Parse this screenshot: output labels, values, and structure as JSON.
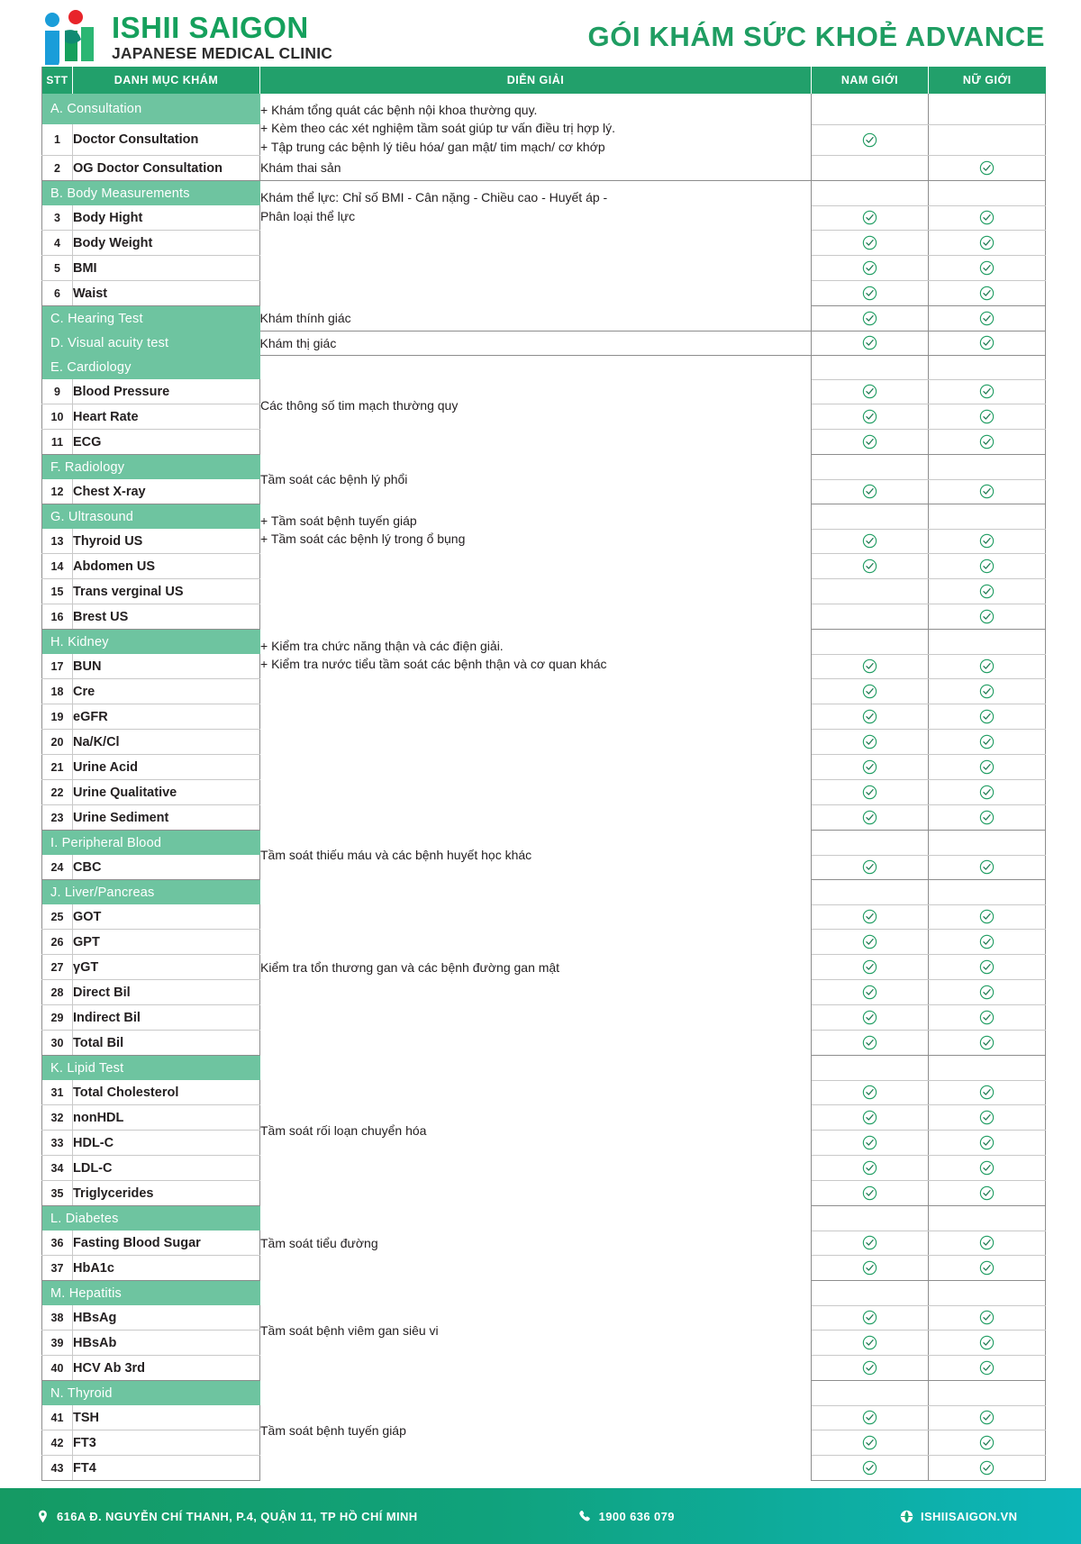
{
  "brand": {
    "name": "ISHII SAIGON",
    "tagline": "JAPANESE MEDICAL CLINIC",
    "logo_icon": "ishii-logo-icon",
    "green": "#15a05c",
    "red": "#e8242a",
    "blue": "#1a9dd9"
  },
  "document": {
    "title": "GÓI KHÁM SỨC KHOẺ ADVANCE",
    "header_green": "#22a06b",
    "section_green": "#6ec4a0",
    "tick_green": "#1f9d62"
  },
  "table": {
    "columns": [
      "STT",
      "DANH MỤC KHÁM",
      "DIỄN GIẢI",
      "NAM GIỚI",
      "NỮ GIỚI"
    ],
    "groups": [
      {
        "section": "A. Consultation",
        "section_has_desc": false,
        "blocks": [
          {
            "desc": "+ Khám tổng quát các bệnh nội khoa thường quy.\n+ Kèm theo các xét nghiệm tầm soát giúp tư vấn điều trị hợp lý.\n+ Tập trung các bệnh lý tiêu hóa/ gan mật/ tim mạch/ cơ khớp",
            "desc_spans_section": true,
            "rows": [
              {
                "stt": "1",
                "name": "Doctor Consultation",
                "male": true,
                "female": false
              }
            ]
          },
          {
            "desc": "Khám thai sản",
            "rows": [
              {
                "stt": "2",
                "name": "OG Doctor Consultation",
                "male": false,
                "female": true
              }
            ]
          }
        ]
      },
      {
        "section": "B. Body Measurements",
        "blocks": [
          {
            "desc": "Khám thể lực: Chỉ số BMI - Cân nặng - Chiều cao - Huyết áp -\nPhân loại thể lực",
            "desc_spans_section": true,
            "rows": [
              {
                "stt": "3",
                "name": "Body Hight",
                "male": true,
                "female": true
              },
              {
                "stt": "4",
                "name": "Body Weight",
                "male": true,
                "female": true
              },
              {
                "stt": "5",
                "name": "BMI",
                "male": true,
                "female": true
              },
              {
                "stt": "6",
                "name": "Waist",
                "male": true,
                "female": true
              }
            ]
          }
        ]
      },
      {
        "section": "C. Hearing Test",
        "section_inline_desc": "Khám thính giác",
        "section_male": true,
        "section_female": true,
        "blocks": []
      },
      {
        "section": "D. Visual acuity test",
        "section_inline_desc": "Khám thị giác",
        "section_male": true,
        "section_female": true,
        "blocks": []
      },
      {
        "section": "E. Cardiology",
        "blocks": [
          {
            "desc": "Các thông số tim mạch thường quy",
            "desc_spans_section": true,
            "rows": [
              {
                "stt": "9",
                "name": "Blood Pressure",
                "male": true,
                "female": true
              },
              {
                "stt": "10",
                "name": "Heart Rate",
                "male": true,
                "female": true
              },
              {
                "stt": "11",
                "name": "ECG",
                "male": true,
                "female": true
              }
            ]
          }
        ]
      },
      {
        "section": "F. Radiology",
        "blocks": [
          {
            "desc": "Tầm soát các bệnh lý phổi",
            "desc_spans_section": true,
            "rows": [
              {
                "stt": "12",
                "name": "Chest X-ray",
                "male": true,
                "female": true
              }
            ]
          }
        ]
      },
      {
        "section": "G. Ultrasound",
        "blocks": [
          {
            "desc": "+ Tầm soát bệnh tuyến giáp\n+ Tầm soát các bệnh lý trong ổ bụng",
            "desc_spans_section": true,
            "rows": [
              {
                "stt": "13",
                "name": "Thyroid US",
                "male": true,
                "female": true
              },
              {
                "stt": "14",
                "name": "Abdomen US",
                "male": true,
                "female": true
              },
              {
                "stt": "15",
                "name": "Trans verginal US",
                "male": false,
                "female": true
              },
              {
                "stt": "16",
                "name": "Brest US",
                "male": false,
                "female": true
              }
            ]
          }
        ]
      },
      {
        "section": "H. Kidney",
        "blocks": [
          {
            "desc": "+ Kiểm tra chức năng thận và các điện giải.\n+ Kiểm tra nước tiểu tầm soát các bệnh thận và cơ quan khác",
            "desc_spans_section": true,
            "rows": [
              {
                "stt": "17",
                "name": "BUN",
                "male": true,
                "female": true
              },
              {
                "stt": "18",
                "name": "Cre",
                "male": true,
                "female": true
              },
              {
                "stt": "19",
                "name": "eGFR",
                "male": true,
                "female": true
              },
              {
                "stt": "20",
                "name": "Na/K/Cl",
                "male": true,
                "female": true
              },
              {
                "stt": "21",
                "name": "Urine Acid",
                "male": true,
                "female": true
              },
              {
                "stt": "22",
                "name": "Urine Qualitative",
                "male": true,
                "female": true
              },
              {
                "stt": "23",
                "name": "Urine Sediment",
                "male": true,
                "female": true
              }
            ]
          }
        ]
      },
      {
        "section": "I. Peripheral Blood",
        "blocks": [
          {
            "desc": "Tầm soát thiếu máu và các bệnh huyết học khác",
            "desc_spans_section": true,
            "rows": [
              {
                "stt": "24",
                "name": "CBC",
                "male": true,
                "female": true
              }
            ]
          }
        ]
      },
      {
        "section": "J. Liver/Pancreas",
        "blocks": [
          {
            "desc": "Kiểm tra tổn thương gan và các bệnh đường gan mật",
            "desc_spans_section": true,
            "rows": [
              {
                "stt": "25",
                "name": "GOT",
                "male": true,
                "female": true
              },
              {
                "stt": "26",
                "name": "GPT",
                "male": true,
                "female": true
              },
              {
                "stt": "27",
                "name": "γGT",
                "male": true,
                "female": true
              },
              {
                "stt": "28",
                "name": "Direct Bil",
                "male": true,
                "female": true
              },
              {
                "stt": "29",
                "name": "Indirect Bil",
                "male": true,
                "female": true
              },
              {
                "stt": "30",
                "name": "Total Bil",
                "male": true,
                "female": true
              }
            ]
          }
        ]
      },
      {
        "section": "K. Lipid Test",
        "blocks": [
          {
            "desc": "Tầm soát rối loạn chuyển hóa",
            "desc_spans_section": true,
            "rows": [
              {
                "stt": "31",
                "name": "Total Cholesterol",
                "male": true,
                "female": true
              },
              {
                "stt": "32",
                "name": "nonHDL",
                "male": true,
                "female": true
              },
              {
                "stt": "33",
                "name": "HDL-C",
                "male": true,
                "female": true
              },
              {
                "stt": "34",
                "name": "LDL-C",
                "male": true,
                "female": true
              },
              {
                "stt": "35",
                "name": "Triglycerides",
                "male": true,
                "female": true
              }
            ]
          }
        ]
      },
      {
        "section": "L. Diabetes",
        "blocks": [
          {
            "desc": "Tầm soát tiểu đường",
            "desc_spans_section": true,
            "rows": [
              {
                "stt": "36",
                "name": "Fasting Blood Sugar",
                "male": true,
                "female": true
              },
              {
                "stt": "37",
                "name": "HbA1c",
                "male": true,
                "female": true
              }
            ]
          }
        ]
      },
      {
        "section": "M. Hepatitis",
        "blocks": [
          {
            "desc": "Tầm soát bệnh viêm gan siêu vi",
            "desc_spans_section": true,
            "rows": [
              {
                "stt": "38",
                "name": "HBsAg",
                "male": true,
                "female": true
              },
              {
                "stt": "39",
                "name": "HBsAb",
                "male": true,
                "female": true
              },
              {
                "stt": "40",
                "name": "HCV Ab 3rd",
                "male": true,
                "female": true
              }
            ]
          }
        ]
      },
      {
        "section": "N. Thyroid",
        "blocks": [
          {
            "desc": "Tầm soát bệnh tuyến giáp",
            "desc_spans_section": true,
            "rows": [
              {
                "stt": "41",
                "name": "TSH",
                "male": true,
                "female": true
              },
              {
                "stt": "42",
                "name": "FT3",
                "male": true,
                "female": true
              },
              {
                "stt": "43",
                "name": "FT4",
                "male": true,
                "female": true
              }
            ]
          }
        ]
      }
    ]
  },
  "footer": {
    "address": "616A Đ. NGUYỄN CHÍ THANH, P.4, QUẬN 11, TP HỒ CHÍ MINH",
    "address_icon": "location-pin-icon",
    "phone": "1900 636 079",
    "phone_icon": "phone-icon",
    "website": "ISHIISAIGON.VN",
    "website_icon": "globe-icon"
  }
}
